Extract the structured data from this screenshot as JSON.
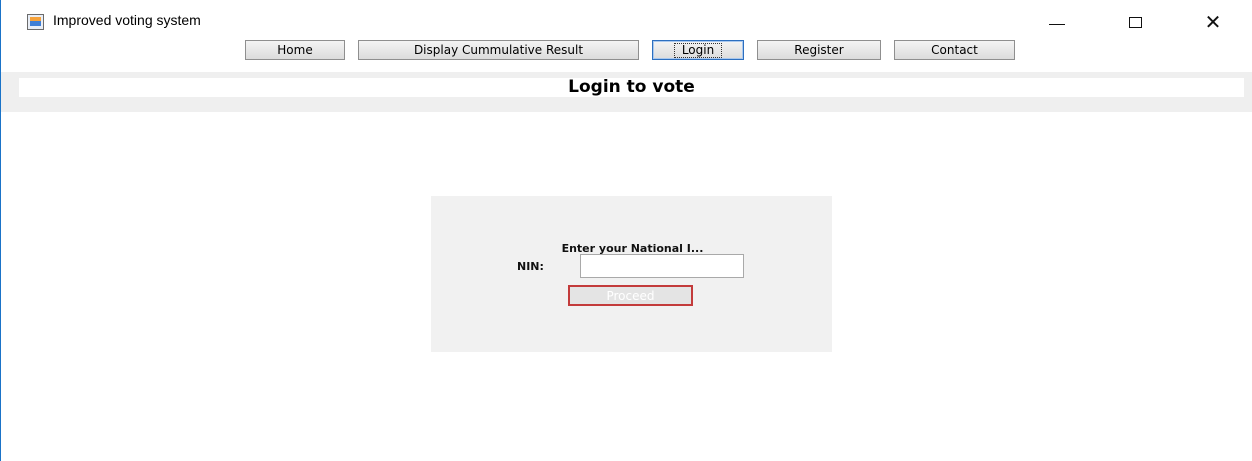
{
  "window": {
    "title": "Improved voting system",
    "controls": {
      "minimize": "",
      "maximize": "",
      "close": "✕"
    }
  },
  "nav": {
    "home": "Home",
    "result": "Display Cummulative Result",
    "login": "Login",
    "register": "Register",
    "contact": "Contact"
  },
  "header": {
    "title": "Login to vote"
  },
  "login": {
    "prompt": "Enter your National I...",
    "nin_label": "NIN:",
    "nin_value": "",
    "proceed": "Proceed"
  },
  "colors": {
    "accent": "#2d6fbf",
    "proceed_border": "#c33b3b",
    "panel_bg": "#f1f1f1"
  }
}
